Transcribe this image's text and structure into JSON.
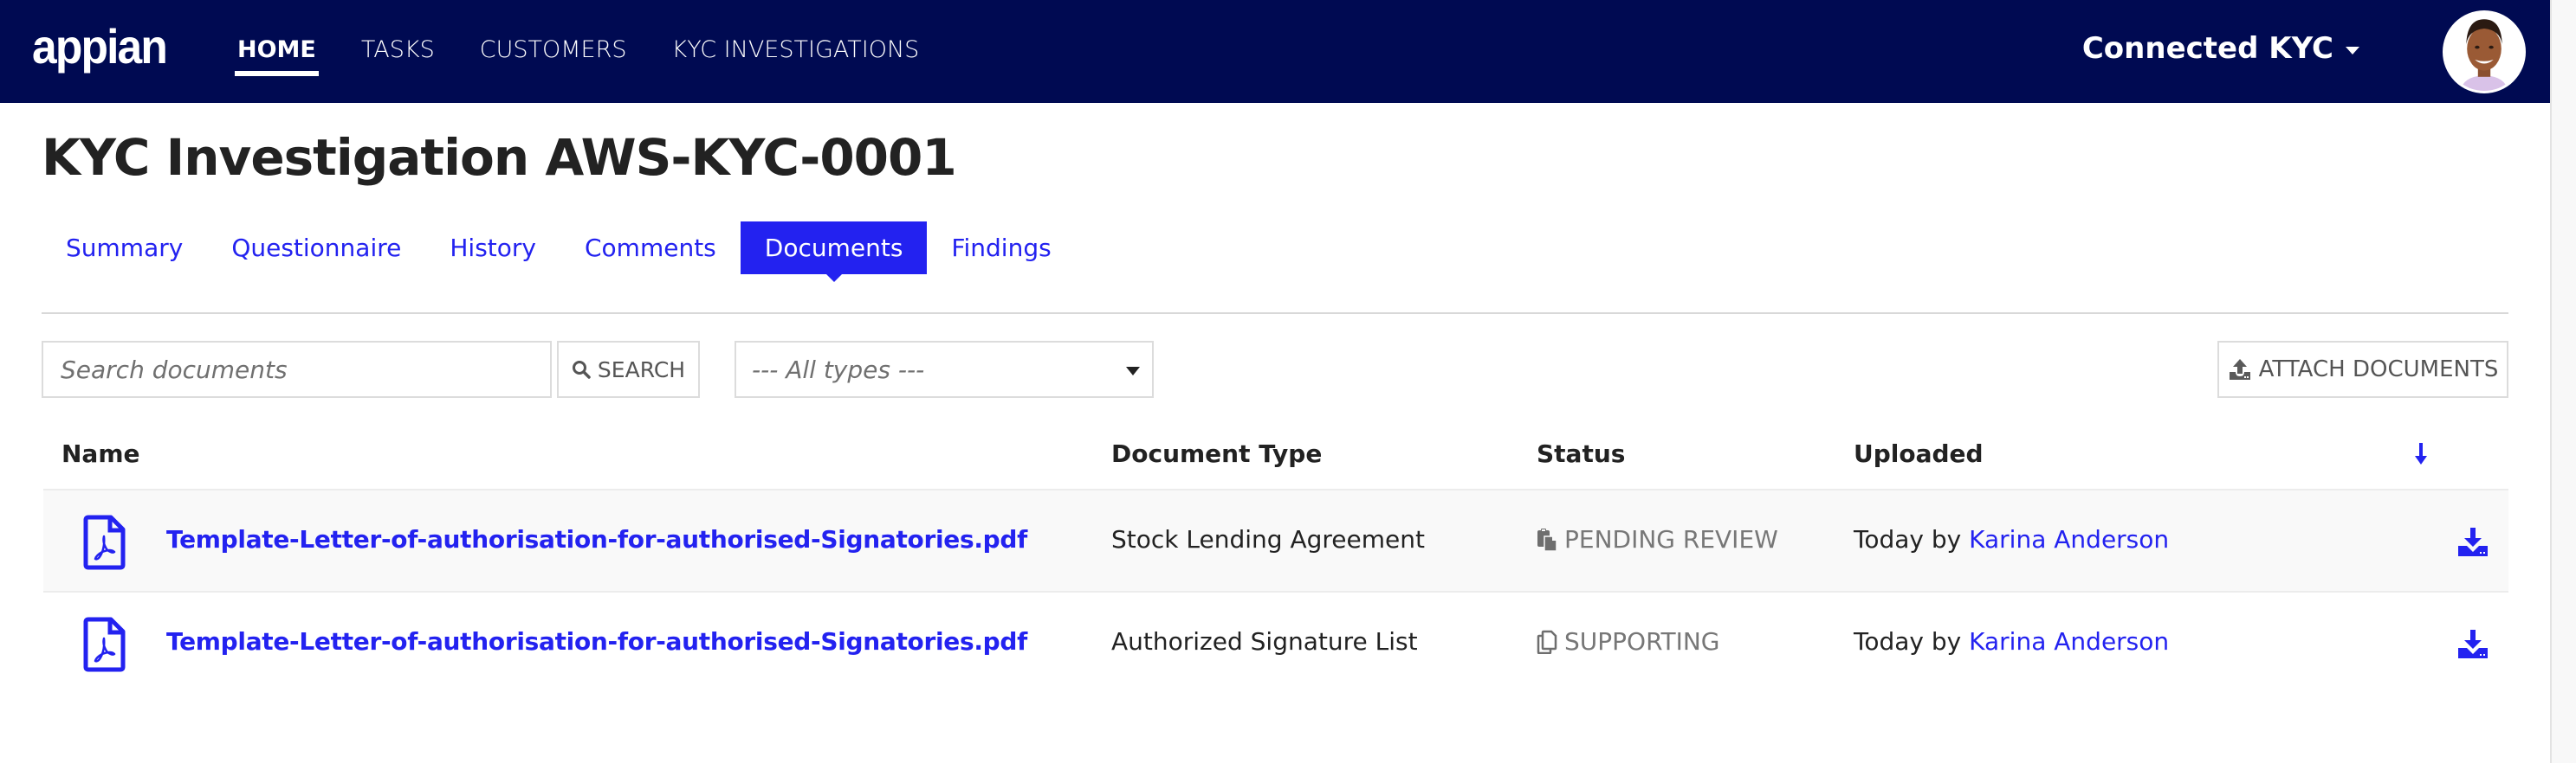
{
  "header": {
    "logo": "appian",
    "nav": [
      {
        "label": "HOME",
        "active": true
      },
      {
        "label": "TASKS",
        "active": false
      },
      {
        "label": "CUSTOMERS",
        "active": false
      },
      {
        "label": "KYC INVESTIGATIONS",
        "active": false
      }
    ],
    "user_menu_label": "Connected KYC",
    "avatar_icon": "user-avatar"
  },
  "page": {
    "title": "KYC Investigation AWS-KYC-0001"
  },
  "tabs": [
    {
      "label": "Summary",
      "active": false
    },
    {
      "label": "Questionnaire",
      "active": false
    },
    {
      "label": "History",
      "active": false
    },
    {
      "label": "Comments",
      "active": false
    },
    {
      "label": "Documents",
      "active": true
    },
    {
      "label": "Findings",
      "active": false
    }
  ],
  "toolbar": {
    "search_placeholder": "Search documents",
    "search_value": "",
    "search_button": "SEARCH",
    "type_filter_value": "--- All types ---",
    "attach_button": "ATTACH DOCUMENTS"
  },
  "table": {
    "columns": [
      "Name",
      "Document Type",
      "Status",
      "Uploaded"
    ],
    "sort_icon": "arrow-down-icon",
    "rows": [
      {
        "name": "Template-Letter-of-authorisation-for-authorised-Signatories.pdf",
        "file_icon": "pdf-file-icon",
        "document_type": "Stock Lending Agreement",
        "status": "PENDING REVIEW",
        "status_icon": "paste-icon",
        "uploaded_prefix": "Today by",
        "uploaded_by": "Karina Anderson"
      },
      {
        "name": "Template-Letter-of-authorisation-for-authorised-Signatories.pdf",
        "file_icon": "pdf-file-icon",
        "document_type": "Authorized Signature List",
        "status": "SUPPORTING",
        "status_icon": "copy-icon",
        "uploaded_prefix": "Today by",
        "uploaded_by": "Karina Anderson"
      }
    ]
  },
  "colors": {
    "header_bg": "#000a52",
    "accent": "#2322f0",
    "status_text": "#777777"
  }
}
